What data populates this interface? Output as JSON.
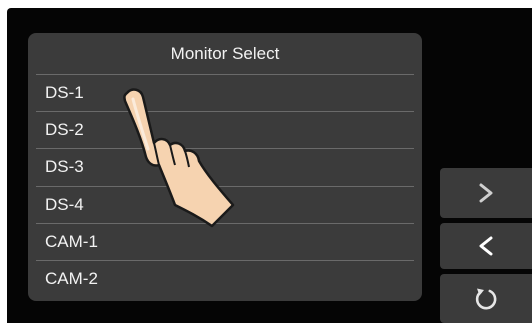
{
  "dialog": {
    "title": "Monitor Select",
    "items": [
      {
        "label": "DS-1"
      },
      {
        "label": "DS-2"
      },
      {
        "label": "DS-3"
      },
      {
        "label": "DS-4"
      },
      {
        "label": "CAM-1"
      },
      {
        "label": "CAM-2"
      }
    ]
  },
  "nav": {
    "next_icon": "chevron-right-icon",
    "back_icon": "chevron-left-icon",
    "rotate_icon": "rotate-icon"
  },
  "overlay": {
    "gesture_icon": "pointing-hand-icon"
  },
  "colors": {
    "screen_bg": "#050505",
    "panel_bg": "#3b3b3b",
    "separator": "#6a6a6a",
    "text": "#f2f2f2"
  }
}
